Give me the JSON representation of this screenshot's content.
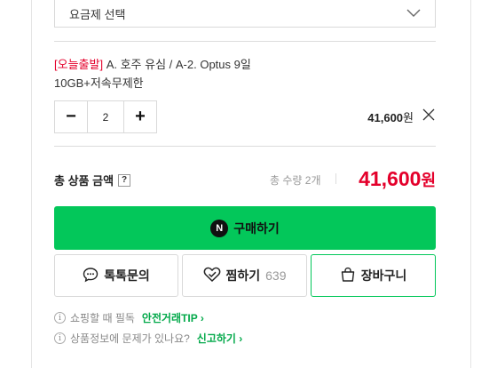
{
  "plan_select": {
    "label": "요금제 선택"
  },
  "option": {
    "tag": "[오늘출발]",
    "name": "A. 호주 유심 / A-2. Optus 9일",
    "detail": "10GB+저속무제한"
  },
  "stepper": {
    "minus": "−",
    "quantity": "2",
    "plus": "+"
  },
  "item_price": {
    "amount": "41,600",
    "unit": "원"
  },
  "total": {
    "label": "총 상품 금액",
    "help": "?",
    "quantity_text": "총 수량 2개",
    "amount": "41,600",
    "unit": "원"
  },
  "buy_button": {
    "logo": "N",
    "label": "구매하기"
  },
  "talk_button": {
    "label": "톡톡문의"
  },
  "wish_button": {
    "label": "찜하기",
    "count": "639"
  },
  "cart_button": {
    "label": "장바구니"
  },
  "notices": [
    {
      "text": "쇼핑할 때 필독",
      "link": "안전거래TIP ›"
    },
    {
      "text": "상품정보에 문제가 있나요?",
      "link": "신고하기 ›"
    }
  ],
  "colors": {
    "accent_green": "#03c75a",
    "price_red": "#e4002b",
    "tag_red": "#e4002b"
  },
  "icons": [
    "chevron-down-icon",
    "close-icon",
    "help-icon",
    "naver-pay-icon",
    "chat-bubble-icon",
    "heart-check-icon",
    "cart-icon",
    "info-icon"
  ]
}
